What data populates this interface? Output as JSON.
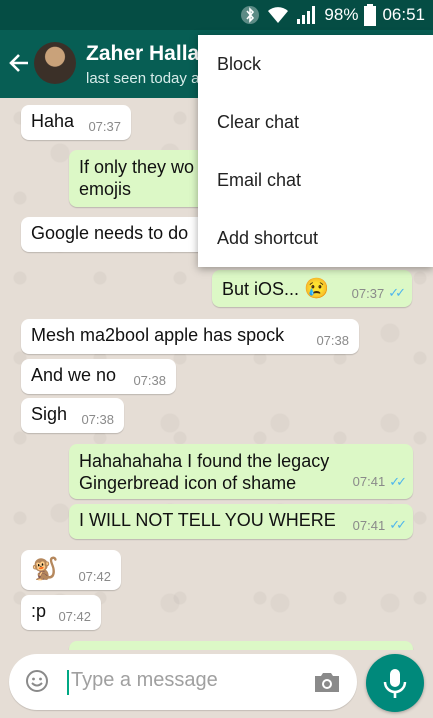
{
  "status": {
    "battery": "98%",
    "time": "06:51"
  },
  "header": {
    "contact_name": "Zaher Halla",
    "last_seen": "last seen today a"
  },
  "menu": [
    {
      "label": "Block"
    },
    {
      "label": "Clear chat"
    },
    {
      "label": "Email chat"
    },
    {
      "label": "Add shortcut"
    }
  ],
  "messages": [
    {
      "text": "Haha",
      "time": "07:37"
    },
    {
      "text": "If only they wo",
      "text2": "emojis"
    },
    {
      "text": "Google needs to do"
    },
    {
      "text": "But iOS...",
      "emoji": "😢",
      "time": "07:37"
    },
    {
      "text": "Mesh ma2bool apple has spock",
      "time": "07:38"
    },
    {
      "text": "And we no",
      "time": "07:38"
    },
    {
      "text": "Sigh",
      "time": "07:38"
    },
    {
      "text": "Hahahahaha I found the legacy",
      "text2": "Gingerbread icon of shame",
      "time": "07:41"
    },
    {
      "text": "I WILL NOT TELL YOU WHERE",
      "time": "07:41"
    },
    {
      "emoji": "🐒",
      "time": "07:42"
    },
    {
      "text": ":p",
      "time": "07:42"
    }
  ],
  "composer": {
    "placeholder": "Type a message"
  },
  "colors": {
    "header": "#075e54",
    "statusbar": "#054d44",
    "outgoing": "#dcf8c6",
    "incoming": "#ffffff",
    "fab": "#00897b",
    "ticks": "#4fb6ec"
  },
  "icons": {
    "back": "arrow-left-icon",
    "emoji": "smiley-icon",
    "camera": "camera-icon",
    "mic": "microphone-icon",
    "bluetooth": "bluetooth-icon",
    "wifi": "wifi-icon",
    "signal": "signal-icon",
    "battery": "battery-icon"
  }
}
